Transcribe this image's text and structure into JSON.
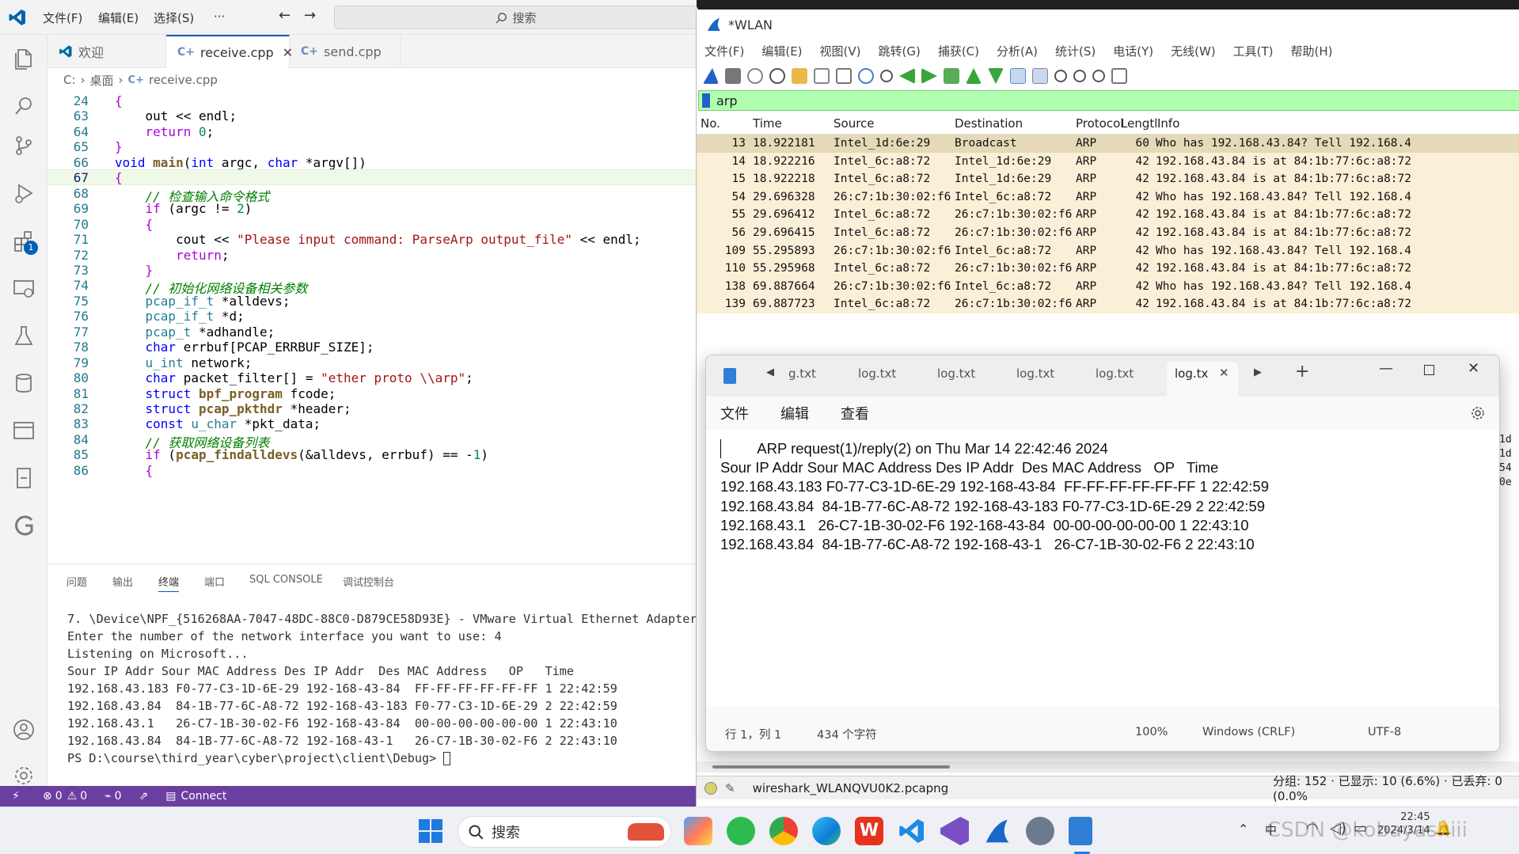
{
  "vscode": {
    "menu": [
      "文件(F)",
      "编辑(E)",
      "选择(S)",
      "···"
    ],
    "search_placeholder": "搜索",
    "tabs": [
      {
        "label": "欢迎"
      },
      {
        "label": "receive.cpp"
      },
      {
        "label": "send.cpp"
      }
    ],
    "breadcrumb": [
      "C:",
      "桌面",
      "receive.cpp"
    ],
    "badge_count": "1",
    "code_lines": [
      {
        "n": "24",
        "html": "<span class='ctl'>{</span>"
      },
      {
        "n": "63",
        "html": "    out &lt;&lt; endl;"
      },
      {
        "n": "64",
        "html": "    <span class='ctl'>return</span> <span class='nm'>0</span>;"
      },
      {
        "n": "65",
        "html": "<span class='ctl'>}</span>"
      },
      {
        "n": "66",
        "html": "<span class='kw'>void</span> <span class='fn'>main</span>(<span class='kw'>int</span> argc, <span class='kw'>char</span> *argv[])"
      },
      {
        "n": "67",
        "html": "<span class='ctl'>{</span>"
      },
      {
        "n": "68",
        "html": "    <span class='cm'>// 检查输入命令格式</span>"
      },
      {
        "n": "69",
        "html": "    <span class='ctl'>if</span> (argc != <span class='nm'>2</span>)"
      },
      {
        "n": "70",
        "html": "    <span class='ctl'>{</span>"
      },
      {
        "n": "71",
        "html": "        cout &lt;&lt; <span class='st'>\"Please input command: ParseArp output_file\"</span> &lt;&lt; endl;"
      },
      {
        "n": "72",
        "html": "        <span class='ctl'>return</span>;"
      },
      {
        "n": "73",
        "html": "    <span class='ctl'>}</span>"
      },
      {
        "n": "74",
        "html": "    <span class='cm'>// 初始化网络设备相关参数</span>"
      },
      {
        "n": "75",
        "html": "    <span class='ty'>pcap_if_t</span> *alldevs;"
      },
      {
        "n": "76",
        "html": "    <span class='ty'>pcap_if_t</span> *d;"
      },
      {
        "n": "77",
        "html": "    <span class='ty'>pcap_t</span> *adhandle;"
      },
      {
        "n": "78",
        "html": "    <span class='kw'>char</span> errbuf[PCAP_ERRBUF_SIZE];"
      },
      {
        "n": "79",
        "html": "    <span class='ty'>u_int</span> network;"
      },
      {
        "n": "80",
        "html": "    <span class='kw'>char</span> packet_filter[] = <span class='st'>\"ether proto \\\\arp\"</span>;"
      },
      {
        "n": "81",
        "html": "    <span class='kw'>struct</span> <span class='fn'>bpf_program</span> fcode;"
      },
      {
        "n": "82",
        "html": "    <span class='kw'>struct</span> <span class='fn'>pcap_pkthdr</span> *header;"
      },
      {
        "n": "83",
        "html": "    <span class='kw'>const</span> <span class='ty'>u_char</span> *pkt_data;"
      },
      {
        "n": "84",
        "html": "    <span class='cm'>// 获取网络设备列表</span>"
      },
      {
        "n": "85",
        "html": "    <span class='ctl'>if</span> (<span class='fn'>pcap_findalldevs</span>(&amp;alldevs, errbuf) == -<span class='nm'>1</span>)"
      },
      {
        "n": "86",
        "html": "    <span class='ctl'>{</span>"
      }
    ],
    "panel_tabs": [
      "问题",
      "输出",
      "终端",
      "端口",
      "SQL CONSOLE",
      "调试控制台"
    ],
    "terminal": [
      "7. \\Device\\NPF_{516268AA-7047-48DC-88C0-D879CE58D93E} - VMware Virtual Ethernet Adapter",
      "Enter the number of the network interface you want to use: 4",
      "Listening on Microsoft...",
      "Sour IP Addr Sour MAC Address Des IP Addr  Des MAC Address   OP   Time",
      "192.168.43.183 F0-77-C3-1D-6E-29 192-168-43-84  FF-FF-FF-FF-FF-FF 1 22:42:59",
      "192.168.43.84  84-1B-77-6C-A8-72 192-168-43-183 F0-77-C3-1D-6E-29 2 22:42:59",
      "192.168.43.1   26-C7-1B-30-02-F6 192-168-43-84  00-00-00-00-00-00 1 22:43:10",
      "192.168.43.84  84-1B-77-6C-A8-72 192-168-43-1   26-C7-1B-30-02-F6 2 22:43:10",
      "PS D:\\course\\third_year\\cyber\\project\\client\\Debug> "
    ],
    "status": {
      "errors": "0",
      "warnings": "0",
      "ports": "0",
      "connect": "Connect"
    }
  },
  "wireshark": {
    "title": "*WLAN",
    "menu": [
      "文件(F)",
      "编辑(E)",
      "视图(V)",
      "跳转(G)",
      "捕获(C)",
      "分析(A)",
      "统计(S)",
      "电话(Y)",
      "无线(W)",
      "工具(T)",
      "帮助(H)"
    ],
    "filter": "arp",
    "columns": [
      "No.",
      "Time",
      "Source",
      "Destination",
      "Protocol",
      "Lengtl",
      "Info"
    ],
    "rows": [
      {
        "no": "13",
        "time": "18.922181",
        "src": "Intel_1d:6e:29",
        "dst": "Broadcast",
        "proto": "ARP",
        "len": "60",
        "info": "Who has 192.168.43.84? Tell 192.168.4"
      },
      {
        "no": "14",
        "time": "18.922216",
        "src": "Intel_6c:a8:72",
        "dst": "Intel_1d:6e:29",
        "proto": "ARP",
        "len": "42",
        "info": "192.168.43.84 is at 84:1b:77:6c:a8:72"
      },
      {
        "no": "15",
        "time": "18.922218",
        "src": "Intel_6c:a8:72",
        "dst": "Intel_1d:6e:29",
        "proto": "ARP",
        "len": "42",
        "info": "192.168.43.84 is at 84:1b:77:6c:a8:72"
      },
      {
        "no": "54",
        "time": "29.696328",
        "src": "26:c7:1b:30:02:f6",
        "dst": "Intel_6c:a8:72",
        "proto": "ARP",
        "len": "42",
        "info": "Who has 192.168.43.84? Tell 192.168.4"
      },
      {
        "no": "55",
        "time": "29.696412",
        "src": "Intel_6c:a8:72",
        "dst": "26:c7:1b:30:02:f6",
        "proto": "ARP",
        "len": "42",
        "info": "192.168.43.84 is at 84:1b:77:6c:a8:72"
      },
      {
        "no": "56",
        "time": "29.696415",
        "src": "Intel_6c:a8:72",
        "dst": "26:c7:1b:30:02:f6",
        "proto": "ARP",
        "len": "42",
        "info": "192.168.43.84 is at 84:1b:77:6c:a8:72"
      },
      {
        "no": "109",
        "time": "55.295893",
        "src": "26:c7:1b:30:02:f6",
        "dst": "Intel_6c:a8:72",
        "proto": "ARP",
        "len": "42",
        "info": "Who has 192.168.43.84? Tell 192.168.4"
      },
      {
        "no": "110",
        "time": "55.295968",
        "src": "Intel_6c:a8:72",
        "dst": "26:c7:1b:30:02:f6",
        "proto": "ARP",
        "len": "42",
        "info": "192.168.43.84 is at 84:1b:77:6c:a8:72"
      },
      {
        "no": "138",
        "time": "69.887664",
        "src": "26:c7:1b:30:02:f6",
        "dst": "Intel_6c:a8:72",
        "proto": "ARP",
        "len": "42",
        "info": "Who has 192.168.43.84? Tell 192.168.4"
      },
      {
        "no": "139",
        "time": "69.887723",
        "src": "Intel_6c:a8:72",
        "dst": "26:c7:1b:30:02:f6",
        "proto": "ARP",
        "len": "42",
        "info": "192.168.43.84 is at 84:1b:77:6c:a8:72"
      }
    ],
    "side_snippets": [
      "1d",
      "1d",
      "54",
      "0e"
    ],
    "status_file": "wireshark_WLANQVU0K2.pcapng",
    "status_stats": "分组: 152 · 已显示: 10 (6.6%) · 已丢弃: 0 (0.0%"
  },
  "notepad": {
    "tabs": [
      "g.txt",
      "log.txt",
      "log.txt",
      "log.txt",
      "log.txt",
      "log.tx"
    ],
    "menu": [
      "文件",
      "编辑",
      "查看"
    ],
    "lines": [
      "         ARP request(1)/reply(2) on Thu Mar 14 22:42:46 2024",
      "Sour IP Addr Sour MAC Address Des IP Addr  Des MAC Address   OP   Time",
      "192.168.43.183 F0-77-C3-1D-6E-29 192-168-43-84  FF-FF-FF-FF-FF-FF 1 22:42:59",
      "192.168.43.84  84-1B-77-6C-A8-72 192-168-43-183 F0-77-C3-1D-6E-29 2 22:42:59",
      "192.168.43.1   26-C7-1B-30-02-F6 192-168-43-84  00-00-00-00-00-00 1 22:43:10",
      "192.168.43.84  84-1B-77-6C-A8-72 192-168-43-1   26-C7-1B-30-02-F6 2 22:43:10"
    ],
    "status": {
      "position": "行 1，列 1",
      "chars": "434 个字符",
      "zoom": "100%",
      "eol": "Windows (CRLF)",
      "encoding": "UTF-8"
    }
  },
  "taskbar": {
    "search": "搜索",
    "time": "22:45",
    "date": "2024/3/14",
    "watermark": "CSDN @kobayashiii"
  }
}
